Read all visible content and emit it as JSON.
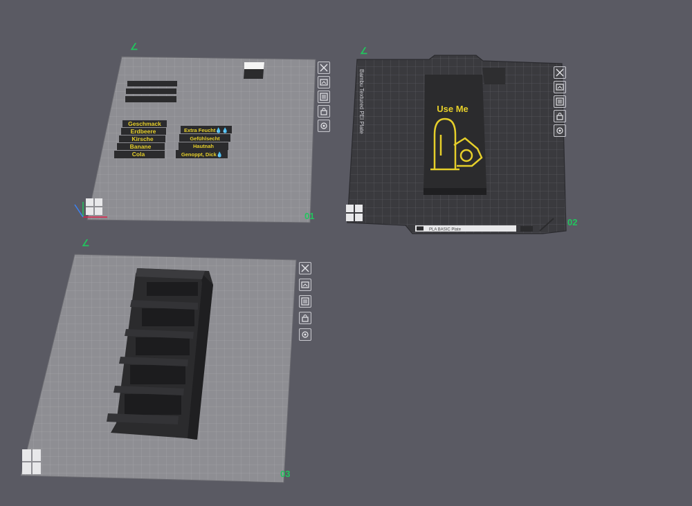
{
  "colors": {
    "background": "#5a5a63",
    "plate_light": "#8e8e93",
    "plate_dark": "#3a3a3e",
    "grid_light": "#a4a4a8",
    "grid_dark": "#55555b",
    "model_dark": "#2b2b2d",
    "label_yellow": "#e6cf2a",
    "plate_number": "#22c55e"
  },
  "plates": [
    {
      "number": "01",
      "labels_left": [
        "Geschmack",
        "Erdbeere",
        "Kirsche",
        "Banane",
        "Cola"
      ],
      "labels_right": [
        "Extra Feucht💧💧",
        "Gefühlsecht",
        "Hautnah",
        "Genoppt, Dick💧"
      ]
    },
    {
      "number": "02",
      "side_text": "Bambu Textured PEI Plate",
      "model_text": "Use Me",
      "bottom_strip": "PLA BASIC Plate"
    },
    {
      "number": "03"
    }
  ],
  "plate_tools": [
    {
      "name": "close-icon",
      "glyph": "×"
    },
    {
      "name": "arrange-icon",
      "glyph": "⟲"
    },
    {
      "name": "orient-icon",
      "glyph": "☰"
    },
    {
      "name": "lock-icon",
      "glyph": "🔒"
    },
    {
      "name": "settings-icon",
      "glyph": "⚙"
    }
  ]
}
